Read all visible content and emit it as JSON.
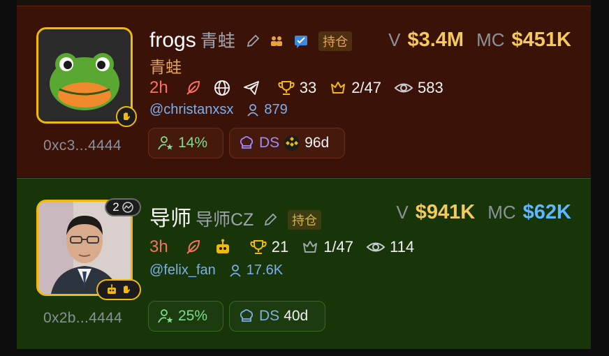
{
  "tokens": [
    {
      "name": "frogs",
      "subname": "青蛙",
      "tag": "持仓",
      "second_line": "青蛙",
      "volume_label": "V",
      "volume": "$3.4M",
      "mc_label": "MC",
      "mc": "$451K",
      "age": "2h",
      "trophy_count": "33",
      "crown_count": "2/47",
      "views": "583",
      "handle": "@christanxsx",
      "followers": "879",
      "address": "0xc3...4444",
      "holder_pct": "14%",
      "ds_label": "DS",
      "ds_days": "96d"
    },
    {
      "name": "导师",
      "subname": "导师CZ",
      "tag": "持仓",
      "volume_label": "V",
      "volume": "$941K",
      "mc_label": "MC",
      "mc": "$62K",
      "age": "3h",
      "trophy_count": "21",
      "crown_count": "1/47",
      "views": "114",
      "handle": "@felix_fan",
      "followers": "17.6K",
      "address": "0x2b...4444",
      "holder_pct": "25%",
      "ds_label": "DS",
      "ds_days": "40d",
      "badge_count": "2"
    }
  ],
  "colors": {
    "accent": "#f0b90b",
    "card1_bg": "#3b1208",
    "card2_bg": "#173509",
    "age": "#ff6f61",
    "money": "#f4c95d",
    "mc_blue": "#5fb7ff"
  },
  "icons": [
    "edit-icon",
    "people-icon",
    "chat-verified-icon",
    "feather-icon",
    "globe-icon",
    "telegram-icon",
    "trophy-icon",
    "crown-icon",
    "eye-icon",
    "user-icon",
    "user-star-icon",
    "chef-hat-icon",
    "bnb-icon",
    "robot-icon",
    "hand-icon"
  ]
}
